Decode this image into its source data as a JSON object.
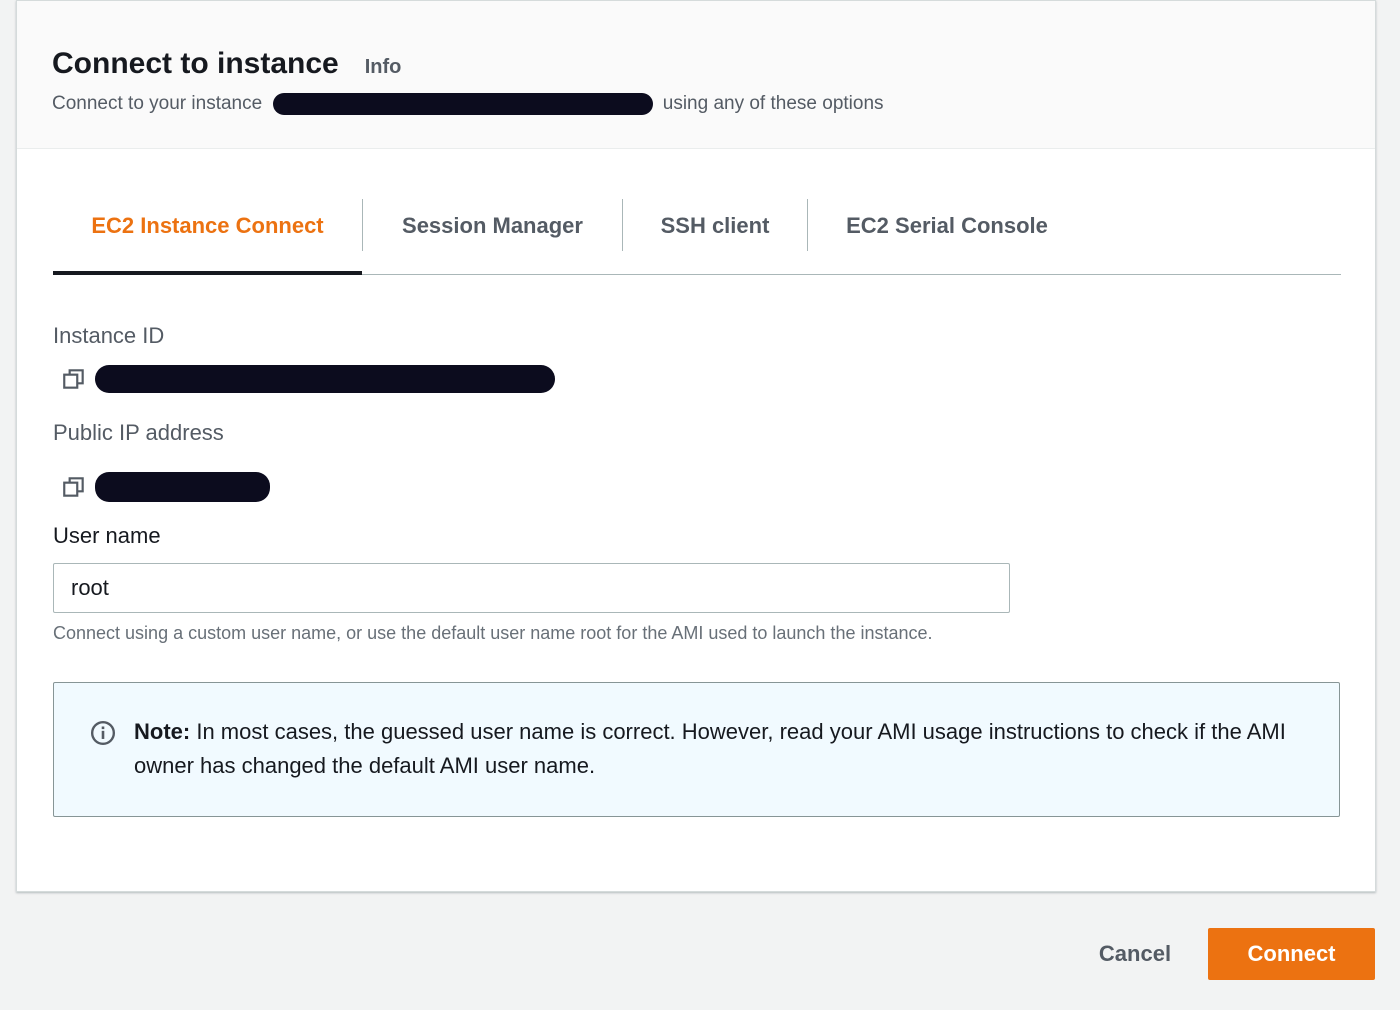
{
  "header": {
    "title": "Connect to instance",
    "info_label": "Info",
    "subtitle_prefix": "Connect to your instance",
    "subtitle_suffix": "using any of these options"
  },
  "tabs": [
    {
      "label": "EC2 Instance Connect",
      "active": true
    },
    {
      "label": "Session Manager",
      "active": false
    },
    {
      "label": "SSH client",
      "active": false
    },
    {
      "label": "EC2 Serial Console",
      "active": false
    }
  ],
  "fields": {
    "instance_id_label": "Instance ID",
    "public_ip_label": "Public IP address"
  },
  "username": {
    "label": "User name",
    "value": "root",
    "help": "Connect using a custom user name, or use the default user name root for the AMI used to launch the instance."
  },
  "alert": {
    "title": "Note:",
    "body": "In most cases, the guessed user name is correct. However, read your AMI usage instructions to check if the AMI owner has changed the default AMI user name."
  },
  "footer": {
    "cancel_label": "Cancel",
    "connect_label": "Connect"
  },
  "colors": {
    "accent": "#ec7211",
    "text": "#16191f",
    "secondary": "#545b64",
    "alert_bg": "#f1faff"
  },
  "icons": {
    "copy": "copy-icon",
    "info": "info-circle-icon"
  }
}
